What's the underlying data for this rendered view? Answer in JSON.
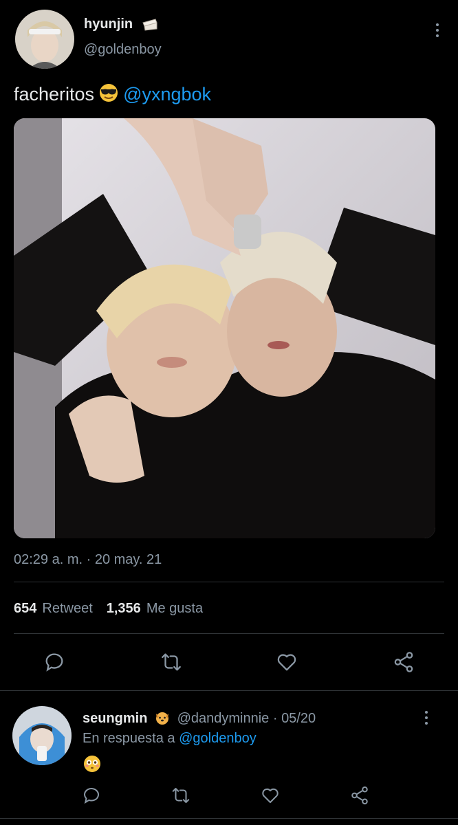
{
  "tweet": {
    "author": {
      "display_name": "hyunjin",
      "name_emoji": "clapper-board-emoji",
      "handle": "@goldenboy"
    },
    "text": "facheritos",
    "text_emoji": "sunglasses-emoji",
    "mention": "@yxngbok",
    "timestamp": "02:29 a. m. · 20 may. 21",
    "stats": {
      "retweets_count": "654",
      "retweets_label": "Retweet",
      "likes_count": "1,356",
      "likes_label": "Me gusta"
    },
    "actions": [
      "reply-icon",
      "retweet-icon",
      "like-icon",
      "share-icon"
    ]
  },
  "reply": {
    "display_name": "seungmin",
    "name_emoji": "puppy-face-emoji",
    "meta": "@dandyminnie · 05/20",
    "reply_prefix": "En respuesta a",
    "reply_mention": "@goldenboy",
    "body_emoji": "flushed-face-emoji",
    "actions": [
      "reply-icon",
      "retweet-icon",
      "like-icon",
      "share-icon"
    ]
  },
  "colors": {
    "background": "#000000",
    "text_primary": "#e7e9ea",
    "text_secondary": "#8b98a5",
    "link": "#1d9bf0",
    "divider": "#2f3336"
  }
}
